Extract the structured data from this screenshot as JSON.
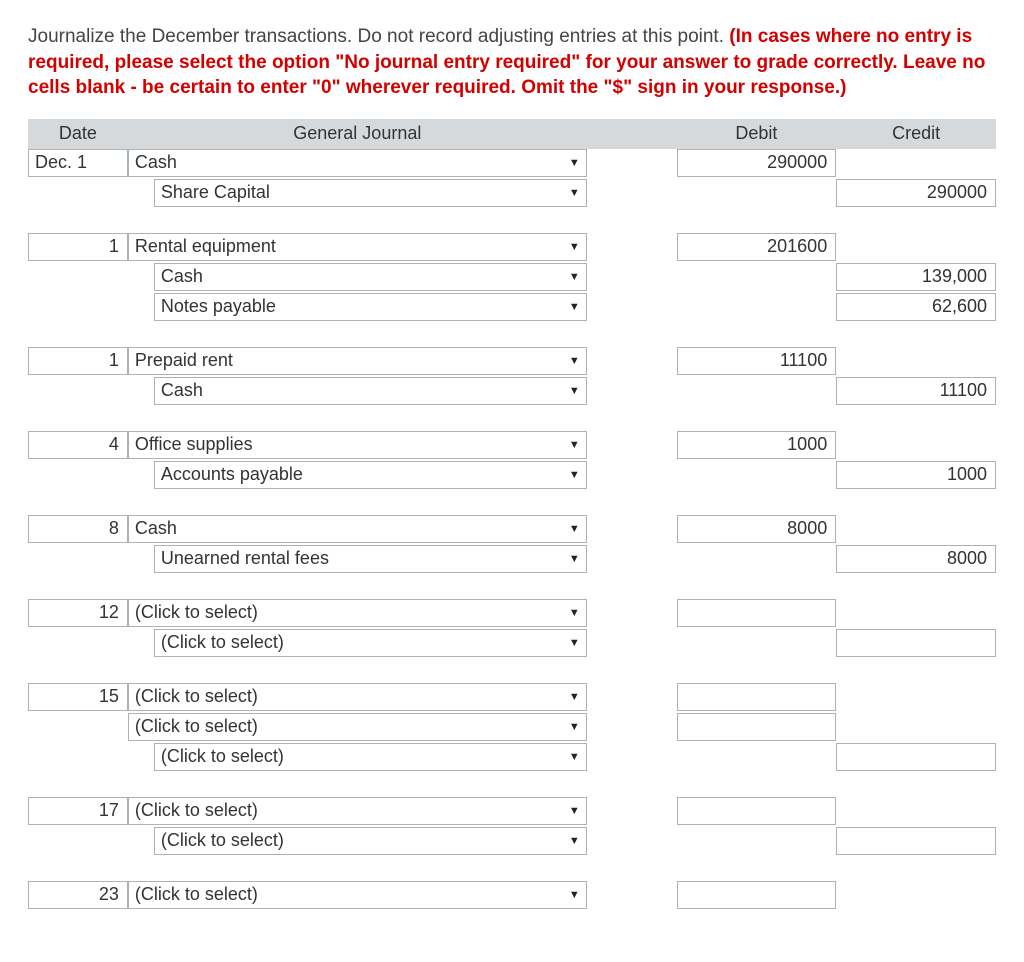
{
  "instructions": {
    "plain": "Journalize the December transactions. Do not record adjusting entries at this point. ",
    "warn": "(In cases where no entry is required, please select the option \"No journal entry required\" for your answer to grade correctly. Leave no cells blank - be certain to enter \"0\" wherever required. Omit the \"$\" sign in your response.)"
  },
  "headers": {
    "date": "Date",
    "journal": "General Journal",
    "debit": "Debit",
    "credit": "Credit"
  },
  "entries": [
    {
      "date": "Dec. 1",
      "lines": [
        {
          "account": "Cash",
          "indent": 0,
          "debit": "290000",
          "credit": ""
        },
        {
          "account": "Share Capital",
          "indent": 1,
          "debit": "",
          "credit": "290000"
        }
      ]
    },
    {
      "date": "1",
      "lines": [
        {
          "account": "Rental equipment",
          "indent": 0,
          "debit": "201600",
          "credit": ""
        },
        {
          "account": "Cash",
          "indent": 1,
          "debit": "",
          "credit": "139,000"
        },
        {
          "account": "Notes payable",
          "indent": 1,
          "debit": "",
          "credit": "62,600"
        }
      ]
    },
    {
      "date": "1",
      "lines": [
        {
          "account": "Prepaid rent",
          "indent": 0,
          "debit": "11100",
          "credit": ""
        },
        {
          "account": "Cash",
          "indent": 1,
          "debit": "",
          "credit": "11100"
        }
      ]
    },
    {
      "date": "4",
      "lines": [
        {
          "account": "Office supplies",
          "indent": 0,
          "debit": "1000",
          "credit": ""
        },
        {
          "account": "Accounts payable",
          "indent": 1,
          "debit": "",
          "credit": "1000"
        }
      ]
    },
    {
      "date": "8",
      "lines": [
        {
          "account": "Cash",
          "indent": 0,
          "debit": "8000",
          "credit": ""
        },
        {
          "account": "Unearned rental fees",
          "indent": 1,
          "debit": "",
          "credit": "8000"
        }
      ]
    },
    {
      "date": "12",
      "lines": [
        {
          "account": "(Click to select)",
          "indent": 0,
          "debit": "",
          "credit": ""
        },
        {
          "account": "(Click to select)",
          "indent": 1,
          "debit": "",
          "credit": ""
        }
      ]
    },
    {
      "date": "15",
      "lines": [
        {
          "account": "(Click to select)",
          "indent": 0,
          "debit": "",
          "credit": ""
        },
        {
          "account": "(Click to select)",
          "indent": 0,
          "debit": "",
          "credit": ""
        },
        {
          "account": "(Click to select)",
          "indent": 1,
          "debit": "",
          "credit": ""
        }
      ]
    },
    {
      "date": "17",
      "lines": [
        {
          "account": "(Click to select)",
          "indent": 0,
          "debit": "",
          "credit": ""
        },
        {
          "account": "(Click to select)",
          "indent": 1,
          "debit": "",
          "credit": ""
        }
      ]
    },
    {
      "date": "23",
      "lines": [
        {
          "account": "(Click to select)",
          "indent": 0,
          "debit": "",
          "credit": ""
        }
      ]
    }
  ]
}
